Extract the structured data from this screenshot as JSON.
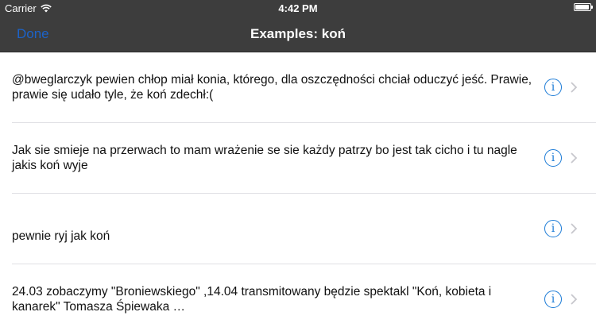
{
  "status_bar": {
    "carrier": "Carrier",
    "time": "4:42 PM",
    "battery_level": 0.95
  },
  "nav": {
    "done_label": "Done",
    "title": "Examples: koń"
  },
  "examples": [
    {
      "text": "@bweglarczyk pewien chłop miał konia, którego, dla oszczędności chciał oduczyć jeść. Prawie, prawie się udało tyle, że koń zdechł:(",
      "info_icon": "info-icon",
      "chevron_icon": "chevron-right-icon"
    },
    {
      "text": "Jak sie smieje na przerwach to mam wrażenie se sie każdy patrzy bo jest tak cicho i tu nagle jakis koń wyje",
      "info_icon": "info-icon",
      "chevron_icon": "chevron-right-icon"
    },
    {
      "text": "pewnie ryj jak koń",
      "info_icon": "info-icon",
      "chevron_icon": "chevron-right-icon"
    },
    {
      "text": "24.03  zobaczymy \"Broniewskiego\" ,14.04  transmitowany będzie spektakl \"Koń, kobieta i kanarek\" Tomasza Śpiewaka …",
      "info_icon": "info-icon",
      "chevron_icon": "chevron-right-icon"
    }
  ],
  "colors": {
    "bar_background": "#3d3d3d",
    "accent": "#1a7ad6",
    "done_blue": "#1c63c9",
    "separator": "#e0e0e4"
  }
}
